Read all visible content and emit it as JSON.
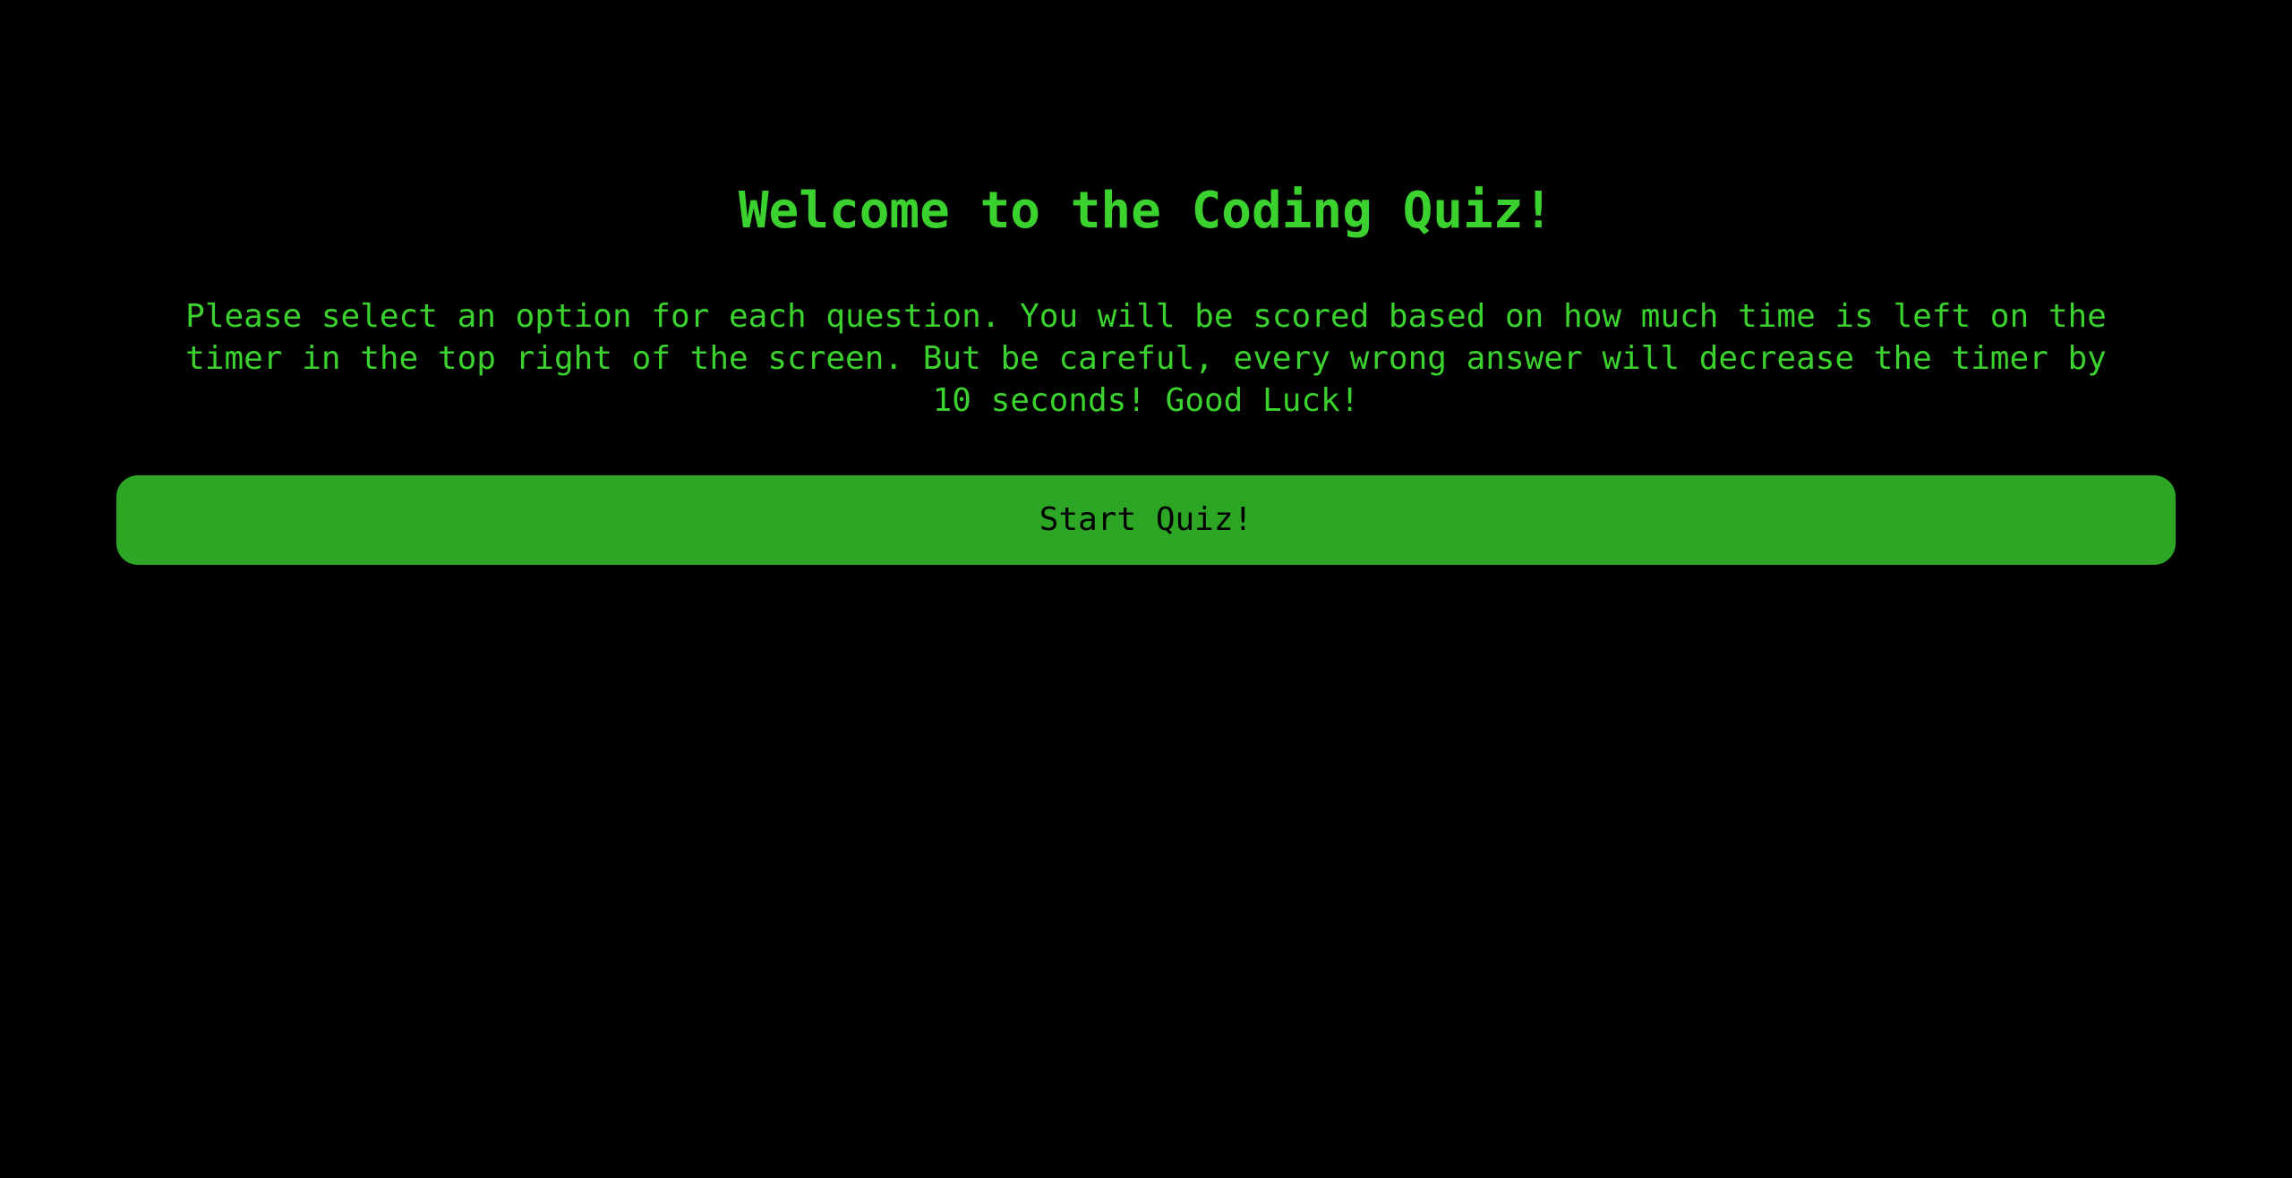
{
  "colors": {
    "background": "#000000",
    "text_green": "#3bd12e",
    "button_green": "#2ca624",
    "button_text": "#000000"
  },
  "start_screen": {
    "title": "Welcome to the Coding Quiz!",
    "instructions": "Please select an option for each question. You will be scored based on how much time is left on the timer in the top right of the screen. But be careful, every wrong answer will decrease the timer by 10 seconds! Good Luck!",
    "start_button_label": "Start Quiz!"
  }
}
